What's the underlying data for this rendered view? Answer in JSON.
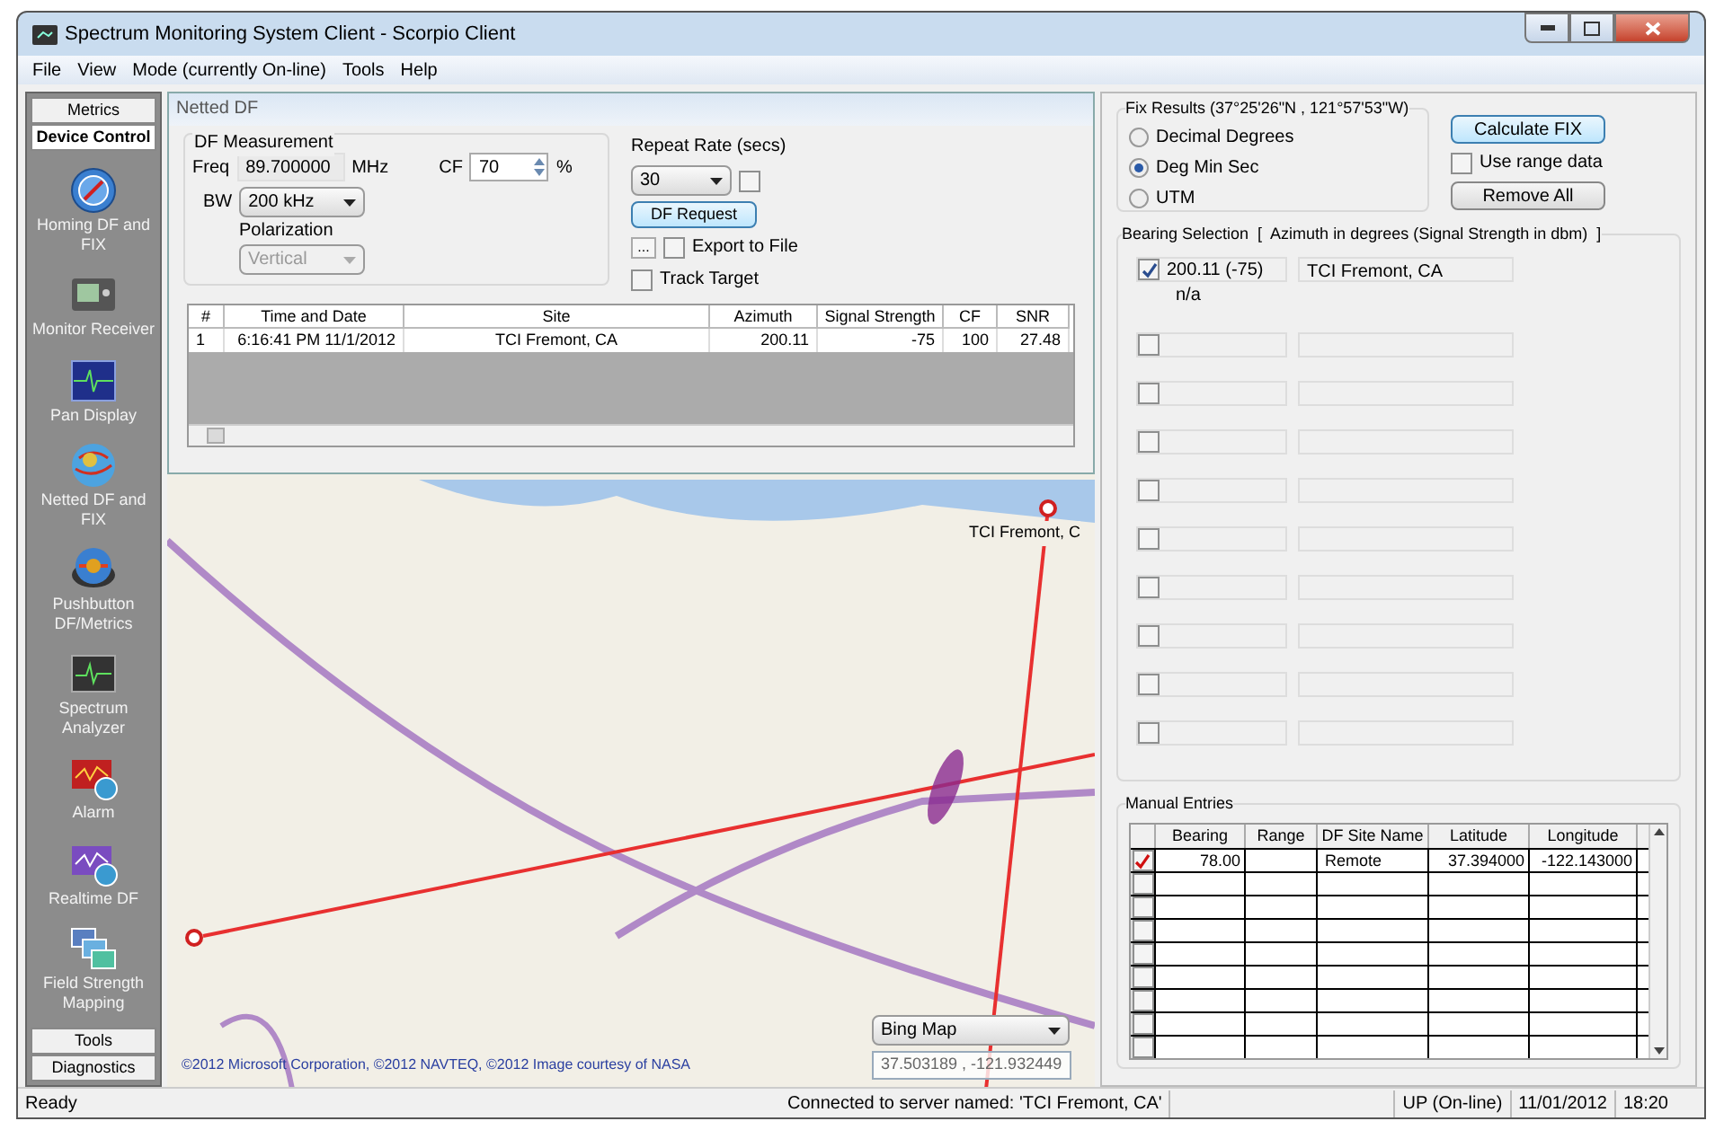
{
  "window": {
    "title": "Spectrum Monitoring System Client - Scorpio Client"
  },
  "menu": [
    "File",
    "View",
    "Mode (currently On-line)",
    "Tools",
    "Help"
  ],
  "sidebar": {
    "top_tabs": [
      {
        "label": "Metrics",
        "selected": false
      },
      {
        "label": "Device Control",
        "selected": true
      }
    ],
    "items": [
      {
        "label": "Homing DF and FIX",
        "kind": "compass"
      },
      {
        "label": "Monitor Receiver",
        "kind": "receiver"
      },
      {
        "label": "Pan Display",
        "kind": "scope"
      },
      {
        "label": "Netted DF and FIX",
        "kind": "globe"
      },
      {
        "label": "Pushbutton DF/Metrics",
        "kind": "disc"
      },
      {
        "label": "Spectrum Analyzer",
        "kind": "analyzer"
      },
      {
        "label": "Alarm",
        "kind": "alarm"
      },
      {
        "label": "Realtime DF",
        "kind": "realtime"
      },
      {
        "label": "Field Strength Mapping",
        "kind": "mapping"
      }
    ],
    "bottom_tabs": [
      {
        "label": "Tools",
        "selected": false
      },
      {
        "label": "Diagnostics",
        "selected": false
      }
    ]
  },
  "netted_df": {
    "title": "Netted DF",
    "measurement": {
      "legend": "DF Measurement",
      "freq_label": "Freq",
      "freq": "89.700000",
      "freq_unit": "MHz",
      "cf_label": "CF",
      "cf": "70",
      "cf_unit": "%",
      "bw_label": "BW",
      "bw": "200 kHz",
      "polarization_label": "Polarization",
      "polarization": "Vertical",
      "polarization_disabled": true
    },
    "repeat_rate": {
      "label": "Repeat Rate (secs)",
      "value": "30",
      "checked": false
    },
    "df_request": "DF Request",
    "browse": "...",
    "export": {
      "label": "Export to File",
      "checked": false
    },
    "track": {
      "label": "Track Target",
      "checked": false
    },
    "table": {
      "columns": [
        "#",
        "Time and Date",
        "Site",
        "Azimuth",
        "Signal Strength",
        "CF",
        "SNR"
      ],
      "rows": [
        [
          "1",
          "6:16:41 PM 11/1/2012",
          "TCI Fremont, CA",
          "200.11",
          "-75",
          "100",
          "27.48"
        ]
      ]
    }
  },
  "map": {
    "site_label": "TCI Fremont, C",
    "copyright": "©2012 Microsoft Corporation, ©2012 NAVTEQ, ©2012 Image courtesy of NASA",
    "map_type": "Bing Map",
    "coordinates": "37.503189 , -121.932449"
  },
  "fix_results": {
    "legend": "Fix Results (37°25'26\"N , 121°57'53\"W)",
    "options": [
      {
        "label": "Decimal Degrees",
        "selected": false
      },
      {
        "label": "Deg Min Sec",
        "selected": true
      },
      {
        "label": "UTM",
        "selected": false
      }
    ],
    "calculate": "Calculate FIX",
    "use_range": {
      "label": "Use range data",
      "checked": false
    },
    "remove_all": "Remove All"
  },
  "bearing_selection": {
    "legend": "Bearing Selection  [  Azimuth in degrees (Signal Strength in dbm)  ]",
    "rows": [
      {
        "checked": true,
        "bearing": "200.11 (-75)",
        "sub": "n/a",
        "site": "TCI Fremont, CA"
      },
      {
        "checked": false
      },
      {
        "checked": false
      },
      {
        "checked": false
      },
      {
        "checked": false
      },
      {
        "checked": false
      },
      {
        "checked": false
      },
      {
        "checked": false
      },
      {
        "checked": false
      },
      {
        "checked": false
      }
    ]
  },
  "manual_entries": {
    "legend": "Manual Entries",
    "columns": [
      "Bearing",
      "Range",
      "DF Site Name",
      "Latitude",
      "Longitude"
    ],
    "rows": [
      {
        "checked": true,
        "cells": [
          "78.00",
          "",
          "Remote",
          "37.394000",
          "-122.143000"
        ]
      },
      {
        "checked": false
      },
      {
        "checked": false
      },
      {
        "checked": false
      },
      {
        "checked": false
      },
      {
        "checked": false
      },
      {
        "checked": false
      },
      {
        "checked": false
      },
      {
        "checked": false
      }
    ]
  },
  "status_bar": {
    "left": "Ready",
    "connection": "Connected to server named: 'TCI Fremont, CA'",
    "state": "UP (On-line)",
    "date": "11/01/2012",
    "time": "18:20"
  }
}
